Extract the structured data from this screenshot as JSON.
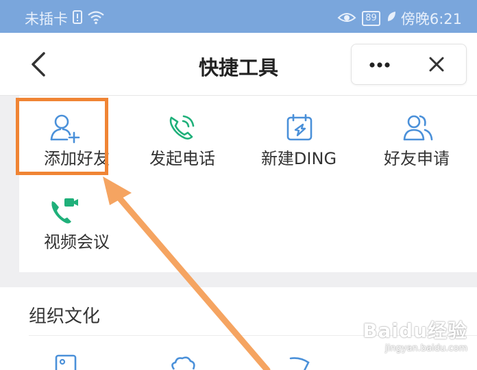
{
  "status_bar": {
    "carrier": "未插卡",
    "battery": "89",
    "time": "傍晚6:21"
  },
  "nav": {
    "title": "快捷工具"
  },
  "tools": [
    {
      "label": "添加好友",
      "icon": "add-friend-icon"
    },
    {
      "label": "发起电话",
      "icon": "phone-call-icon"
    },
    {
      "label": "新建DING",
      "icon": "ding-icon"
    },
    {
      "label": "好友申请",
      "icon": "friend-request-icon"
    },
    {
      "label": "视频会议",
      "icon": "video-meeting-icon"
    }
  ],
  "section": {
    "title": "组织文化"
  },
  "watermark": {
    "main": "Baidu经验",
    "sub": "jingyan.baidu.com"
  },
  "colors": {
    "accent_blue": "#4a90d9",
    "accent_green": "#1fb07a",
    "highlight": "#f08434"
  }
}
